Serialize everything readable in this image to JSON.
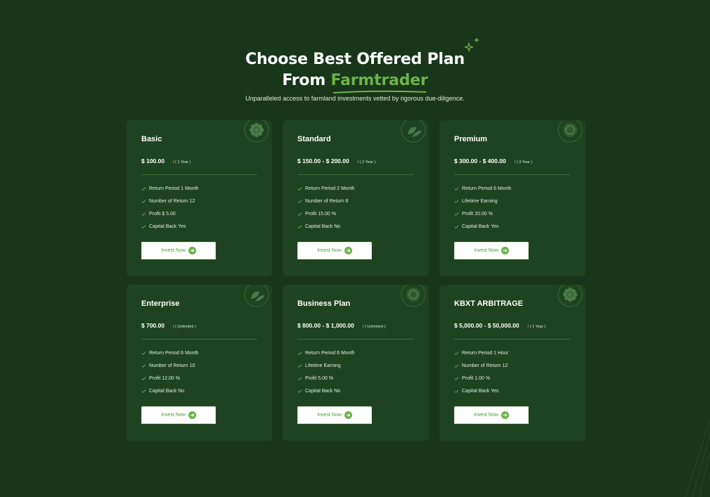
{
  "header": {
    "title_line1": "Choose Best Offered Plan",
    "title_line2_prefix": "From ",
    "brand": "Farmtrader",
    "subtitle": "Unparalleled access to farmland investments vetted by rigorous due-diligence."
  },
  "colors": {
    "background": "#18361a",
    "card": "#1e4320",
    "accent": "#6bb34a",
    "button": "#ffffff"
  },
  "plans": [
    {
      "name": "Basic",
      "price": "$ 100.00",
      "period": "/ ( 1 Year )",
      "icon": "flower-icon",
      "features": [
        "Return Period 1 Month",
        "Number of Return 12",
        "Profit $ 5.00",
        "Capital Back Yes"
      ],
      "button": "Invest Now"
    },
    {
      "name": "Standard",
      "price": "$ 150.00 - $ 200.00",
      "period": "/ ( 2 Year )",
      "icon": "leaf-icon",
      "features": [
        "Return Period 2 Month",
        "Number of Return 6",
        "Profit 15.00 %",
        "Capital Back No"
      ],
      "button": "Invest Now"
    },
    {
      "name": "Premium",
      "price": "$ 300.00 - $ 400.00",
      "period": "/ ( 3 Year )",
      "icon": "sun-icon",
      "features": [
        "Return Period 6 Month",
        "Lifetime Earning",
        "Profit 20.00 %",
        "Capital Back Yes"
      ],
      "button": "Invest Now"
    },
    {
      "name": "Enterprise",
      "price": "$ 700.00",
      "period": "/ ( Unlimited )",
      "icon": "leaf-icon",
      "features": [
        "Return Period 6 Month",
        "Number of Return 10",
        "Profit 12.00 %",
        "Capital Back No"
      ],
      "button": "Invest Now"
    },
    {
      "name": "Business Plan",
      "price": "$ 800.00 - $ 1,000.00",
      "period": "/ ( Unlimited )",
      "icon": "sun-icon",
      "features": [
        "Return Period 6 Month",
        "Lifetime Earning",
        "Profit 5.00 %",
        "Capital Back No"
      ],
      "button": "Invest Now"
    },
    {
      "name": "KBXT ARBITRAGE",
      "price": "$ 5,000.00 - $ 50,000.00",
      "period": "/ ( 1 Year )",
      "icon": "flower-icon",
      "features": [
        "Return Period 1 Hour",
        "Number of Return 12",
        "Profit 1.00 %",
        "Capital Back Yes"
      ],
      "button": "Invest Now"
    }
  ]
}
